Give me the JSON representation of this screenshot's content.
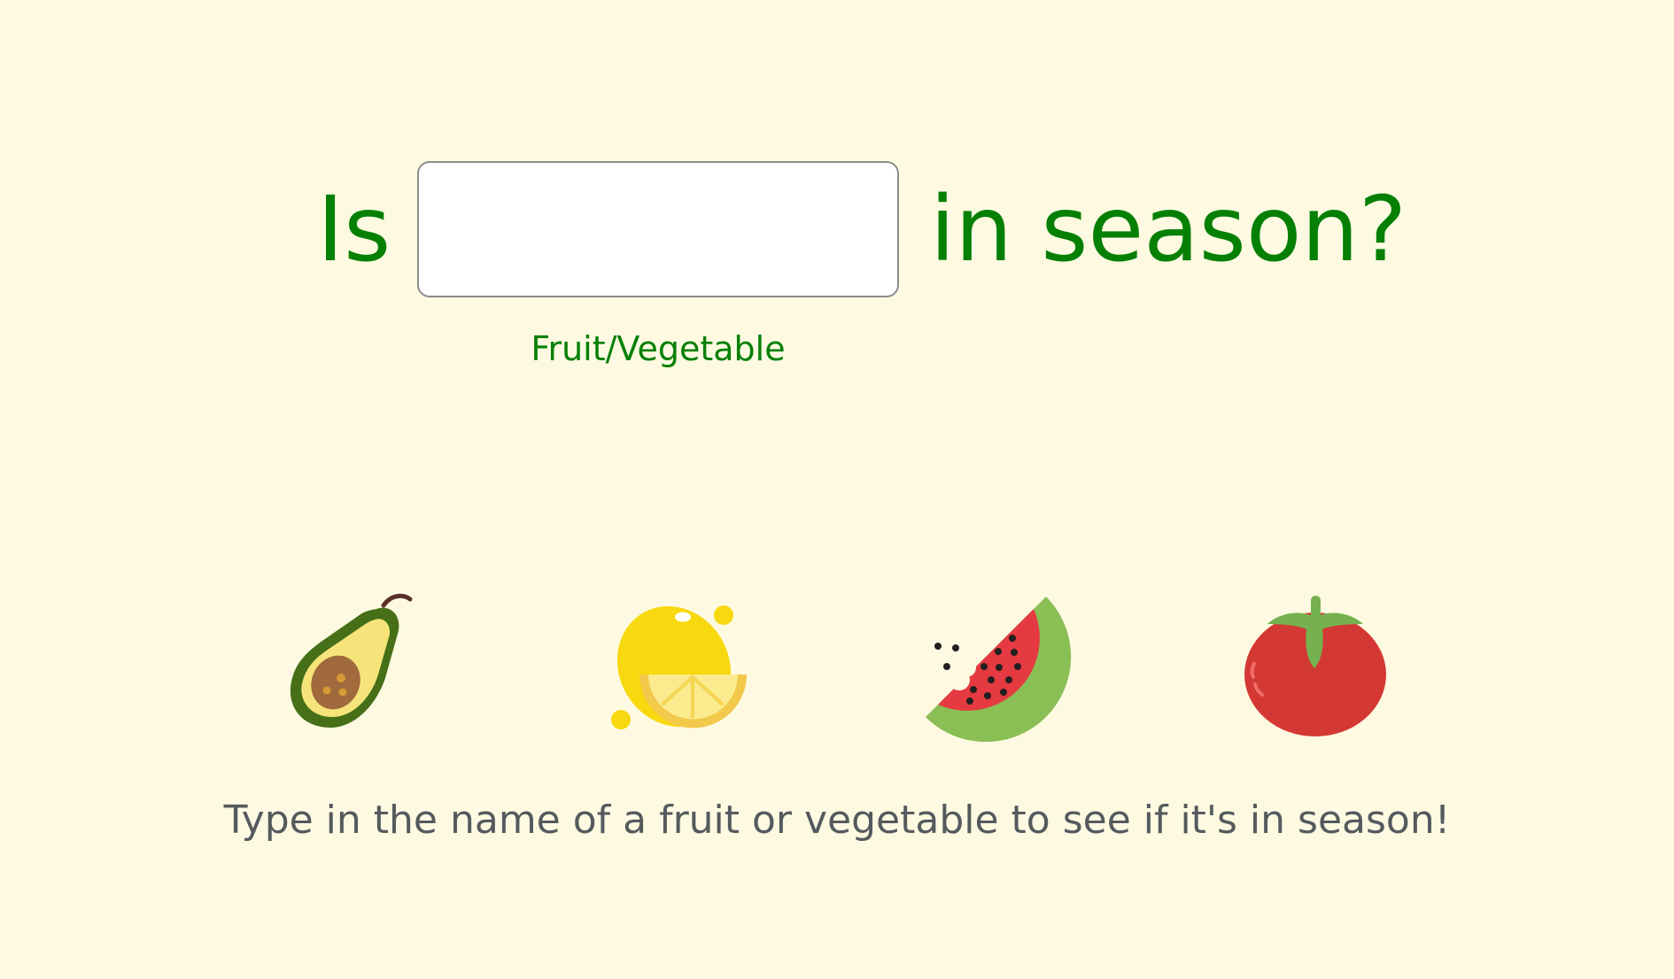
{
  "question": {
    "prefix": "Is",
    "suffix": "in season?"
  },
  "search": {
    "value": "",
    "placeholder": "",
    "caption": "Fruit/Vegetable"
  },
  "icons": [
    {
      "name": "avocado-icon"
    },
    {
      "name": "lemon-icon"
    },
    {
      "name": "watermelon-icon"
    },
    {
      "name": "tomato-icon"
    }
  ],
  "hint": "Type in the name of a fruit or vegetable to see if it's in season!",
  "colors": {
    "background": "#fefae2",
    "accent_green": "#058005",
    "hint_gray": "#555a5e",
    "input_border": "#8c8c8c"
  }
}
